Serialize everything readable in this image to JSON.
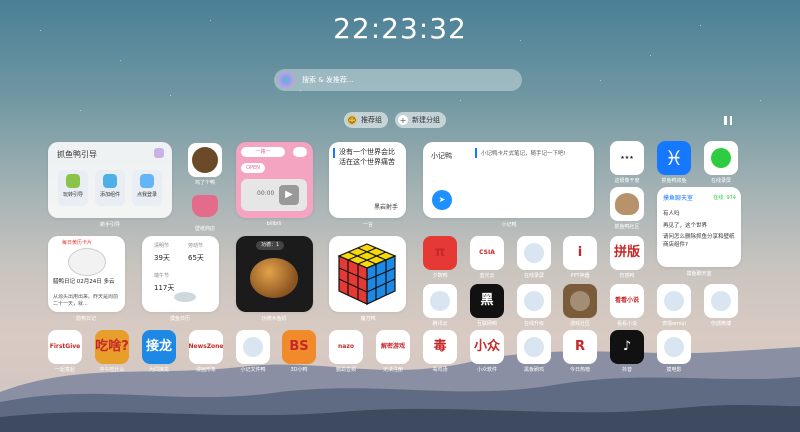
{
  "clock": {
    "time": "22:23:32"
  },
  "search": {
    "placeholder": "搜索 & 发推荐..."
  },
  "groups": {
    "recommended": "推荐组",
    "new_group": "新建分组"
  },
  "widgets": {
    "fish_guide": {
      "title": "抓鱼鸭引导",
      "btn1": "玩转引导",
      "btn2": "添加组件",
      "btn3": "点我登录",
      "caption": "新手引导"
    },
    "duck_games": {
      "caption": "鸡了个鸭"
    },
    "bilibili": {
      "pill": "一路一",
      "open": "OPEN",
      "time": "00:00",
      "caption": "bilibili"
    },
    "quote": {
      "text": "没有一个世界会比活在这个世界痛苦",
      "author": "黑岩射手",
      "caption": "一言"
    },
    "note": {
      "title": "小记鸭",
      "hint": "小记鸭卡片式笔记，随手记一下吧!",
      "caption": "小记鸭"
    },
    "almanac": {
      "top": "每日黄历卡片",
      "date": "腊鸭日记 02月24日 多云",
      "line1": "从源头出用出来。昨天是周前",
      "line2": "二十一天，就...",
      "caption": "腊鸭日记"
    },
    "holiday": {
      "a_name": "清明节",
      "a_days": "39天",
      "b_name": "劳动节",
      "b_days": "65天",
      "c_name": "端午节",
      "c_days": "117天",
      "caption": "摸鱼日历"
    },
    "gourd": {
      "badge": "功德：1",
      "caption": "功德木鱼机"
    },
    "cube": {
      "caption": "魔方鸭"
    },
    "chat": {
      "title": "摸鱼聊天室",
      "online": "在线: 974",
      "msg1": "有人吗",
      "msg2": "再见了，这个世界",
      "msg3": "请问怎么删除抓鱼分享和壁纸商店组件?",
      "caption": "摸鱼聊天室"
    }
  },
  "apps": [
    {
      "label": "壁纸商店",
      "icon": "bouquet-icon",
      "color": "#f4c9d5"
    },
    {
      "label": "这很像干度",
      "icon": "brain-icon",
      "color": "#ffffff"
    },
    {
      "label": "抓鱼鸭双鱼",
      "icon": "pisces-icon",
      "color": "#1677ff",
      "glyph": "♓"
    },
    {
      "label": "在线录屏",
      "icon": "record-icon",
      "color": "#ffffff"
    },
    {
      "label": "抓鱼鸭社区",
      "icon": "dodo-icon",
      "color": "#ffffff"
    },
    {
      "label": "夕数鸭",
      "icon": "pi-icon",
      "color": "#e53935",
      "glyph": "π"
    },
    {
      "label": "蓝光云",
      "icon": "csia-icon",
      "color": "#ffffff",
      "glyph": "CSIA"
    },
    {
      "label": "在线录屏",
      "icon": "leaf-icon",
      "color": "#ffffff"
    },
    {
      "label": "PPT神器",
      "icon": "ppt-icon",
      "color": "#ffffff",
      "glyph": "i"
    },
    {
      "label": "伤感鸭",
      "icon": "sad-icon",
      "color": "#ffffff",
      "glyph": "拼版"
    },
    {
      "label": "腾讯云",
      "icon": "cloud-icon",
      "color": "#ffffff"
    },
    {
      "label": "互联网鸭",
      "icon": "hei-icon",
      "color": "#111111",
      "glyph": "黑"
    },
    {
      "label": "在线升级",
      "icon": "loading-icon",
      "color": "#ffffff"
    },
    {
      "label": "游戏社区",
      "icon": "game-icon",
      "color": "#7b5c3a"
    },
    {
      "label": "看看小说",
      "icon": "novel-icon",
      "color": "#ffffff",
      "glyph": "看看小说"
    },
    {
      "label": "表情emoji",
      "icon": "emoji-icon",
      "color": "#ffffff"
    },
    {
      "label": "伤感微博",
      "icon": "chat-bubble-icon",
      "color": "#ffffff"
    },
    {
      "label": "一起富起",
      "icon": "money-icon",
      "color": "#ffffff",
      "glyph": "FirstGive"
    },
    {
      "label": "中午吃什么",
      "icon": "lunch-icon",
      "color": "#e89e2a",
      "glyph": "吃啥?"
    },
    {
      "label": "为同接龙",
      "icon": "jielong-icon",
      "color": "#1e88e5",
      "glyph": "接龙"
    },
    {
      "label": "漫画形象",
      "icon": "comic-icon",
      "color": "#ffffff",
      "glyph": "NewsZone"
    },
    {
      "label": "小记文件鸭",
      "icon": "printer-icon",
      "color": "#ffffff"
    },
    {
      "label": "3D小鸭",
      "icon": "bs-icon",
      "color": "#f08a2b",
      "glyph": "BS"
    },
    {
      "label": "鹦鹉音频",
      "icon": "nazo-icon",
      "color": "#ffffff",
      "glyph": "nazo"
    },
    {
      "label": "无法注册",
      "icon": "unlock-icon",
      "color": "#ffffff",
      "glyph": "解密游戏"
    },
    {
      "label": "毒鸡汤",
      "icon": "poison-icon",
      "color": "#ffffff",
      "glyph": "毒"
    },
    {
      "label": "小众软件",
      "icon": "xiaozhong-icon",
      "color": "#ffffff",
      "glyph": "小众"
    },
    {
      "label": "黑板刷鸡",
      "icon": "basketball-icon",
      "color": "#ffffff"
    },
    {
      "label": "今日热榜",
      "icon": "r-icon",
      "color": "#ffffff",
      "glyph": "R"
    },
    {
      "label": "抖音",
      "icon": "tiktok-icon",
      "color": "#111111",
      "glyph": "♪"
    },
    {
      "label": "摸电影",
      "icon": "film-duck-icon",
      "color": "#ffffff"
    }
  ]
}
